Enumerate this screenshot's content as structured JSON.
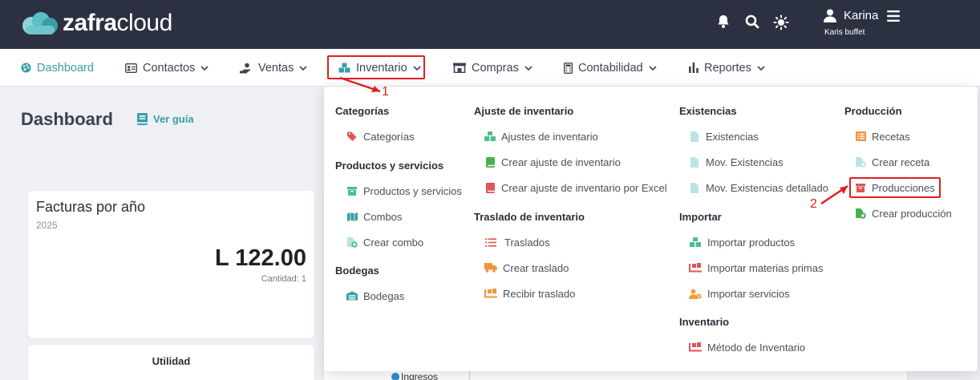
{
  "app": {
    "logo_text": "zafracloud"
  },
  "header": {
    "user_name": "Karina",
    "user_sub": "Karis buffet"
  },
  "nav": {
    "items": [
      {
        "label": "Dashboard",
        "icon": "palette-icon"
      },
      {
        "label": "Contactos",
        "icon": "contact-card-icon"
      },
      {
        "label": "Ventas",
        "icon": "hand-coin-icon"
      },
      {
        "label": "Inventario",
        "icon": "boxes-icon"
      },
      {
        "label": "Compras",
        "icon": "store-icon"
      },
      {
        "label": "Contabilidad",
        "icon": "calculator-icon"
      },
      {
        "label": "Reportes",
        "icon": "bar-chart-icon"
      }
    ]
  },
  "page": {
    "title": "Dashboard",
    "guide_label": "Ver guía"
  },
  "cards": {
    "facturas": {
      "title": "Facturas por año",
      "year": "2025",
      "amount": "L 122.00",
      "qty": "Cantidad: 1"
    },
    "utilidad": {
      "title": "Utilidad"
    },
    "legend_label": "Ingresos"
  },
  "dropdown": {
    "categorias": {
      "title": "Categorías",
      "items": [
        "Categorías"
      ]
    },
    "productos": {
      "title": "Productos y servicios",
      "items": [
        "Productos y servicios",
        "Combos",
        "Crear combo"
      ]
    },
    "bodegas": {
      "title": "Bodegas",
      "items": [
        "Bodegas"
      ]
    },
    "ajuste": {
      "title": "Ajuste de inventario",
      "items": [
        "Ajustes de inventario",
        "Crear ajuste de inventario",
        "Crear ajuste de inventario por Excel"
      ]
    },
    "traslado": {
      "title": "Traslado de inventario",
      "items": [
        "Traslados",
        "Crear traslado",
        "Recibir traslado"
      ]
    },
    "existencias": {
      "title": "Existencias",
      "items": [
        "Existencias",
        "Mov. Existencias",
        "Mov. Existencias detallado"
      ]
    },
    "importar": {
      "title": "Importar",
      "items": [
        "Importar productos",
        "Importar materias primas",
        "Importar servicios"
      ]
    },
    "inventario": {
      "title": "Inventario",
      "items": [
        "Método de Inventario"
      ]
    },
    "produccion": {
      "title": "Producción",
      "items": [
        "Recetas",
        "Crear receta",
        "Producciones",
        "Crear producción"
      ]
    }
  },
  "annotations": {
    "step1": "1",
    "step2": "2"
  },
  "colors": {
    "header_bg": "#2c3142",
    "accent": "#3a9da5",
    "highlight": "#e02020"
  }
}
